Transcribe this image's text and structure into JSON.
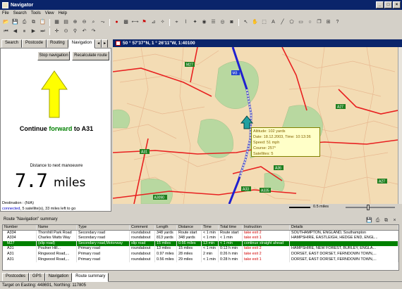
{
  "window": {
    "title": "Navigator"
  },
  "menu": [
    "File",
    "Search",
    "Tools",
    "View",
    "Help"
  ],
  "left_tabs": [
    "Search",
    "Postcode",
    "Routing",
    "Navigation"
  ],
  "left_tab_arrows": [
    "◂",
    "▸"
  ],
  "left_panel": {
    "stop_label": "Stop navigation",
    "recalc_label": "Recalculate route",
    "instruction_prefix": "Continue ",
    "instruction_highlight": "forward",
    "instruction_suffix": " to A31",
    "distance_caption": "Distance to next manoeuvre",
    "distance_value": "7.7",
    "distance_unit": "miles",
    "destination": "Destination : (N/A)",
    "status_prefix": "connected",
    "status_rest": ", 5 satellite(s), 33 miles left to go",
    "arrow_color": "#ffff00",
    "highlight_color": "#008000"
  },
  "map": {
    "header": "50 ° 57'37\"N, 1 ° 26'11\"W, 1:40100",
    "info": {
      "altitude": "Altitude: 102 yards",
      "date": "Date: 18.12.2003, Time: 10:13:36",
      "speed": "Speed: 51 mph",
      "course": "Course: 257°",
      "satellites": "Satellites: 5"
    },
    "road_labels": [
      "M27",
      "A27",
      "A36",
      "A31",
      "A3090",
      "A335",
      "A33",
      "M3",
      "A27"
    ],
    "scale_label": "0.5 miles"
  },
  "summary": {
    "title": "Route \"Navigation\" summary",
    "columns": [
      "Number",
      "Name",
      "Type",
      "Comment",
      "Length",
      "Distance",
      "Time",
      "Total time",
      "Instruction",
      "Details"
    ],
    "rows": [
      [
        "A334",
        "Thornhill Park Road",
        "Secondary road",
        "roundabout",
        "348 yards",
        "Route start",
        "< 1 min",
        "Route start",
        "take exit 2",
        "SOUTHAMPTON, ENGLAND, Southampton"
      ],
      [
        "A334",
        "Charles Watts Way",
        "Secondary road",
        "roundabout",
        "813 yards",
        "348 yards",
        "< 1 min",
        "< 1 min",
        "take exit 1",
        "HAMPSHIRE, EASTLEIGH, HEDGE END, ENGL..."
      ],
      [
        "M27",
        "(slip road)",
        "Secondary road,Motorway",
        "slip road",
        "15 miles",
        "0.66 miles",
        "13 min",
        "< 1 min",
        "continue straight ahead",
        ""
      ],
      [
        "A31",
        "Poulner Hill...",
        "Primary road",
        "roundabout",
        "13 miles",
        "15 miles",
        "< 1 min",
        "0:13 h min",
        "take exit 2",
        "HAMPSHIRE, NEW FOREST, BURLEY, ENGLA..."
      ],
      [
        "A31",
        "Ringwood Road,...",
        "Primary road",
        "roundabout",
        "0.97 miles",
        "28 miles",
        "2 min",
        "0:26 h min",
        "take exit 2",
        "DORSET, EAST DORSET, FERNDOWN TOWN,..."
      ],
      [
        "A31",
        "Ringwood Road,...",
        "Primary road",
        "roundabout",
        "0.56 miles",
        "29 miles",
        "< 1 min",
        "0:28 h min",
        "take exit 1",
        "DORSET, EAST DORSET, FERNDOWN TOWN,..."
      ]
    ],
    "selected_row": 2,
    "tabs": [
      "Postcodes",
      "GPS",
      "Navigation",
      "Route summary"
    ]
  },
  "statusbar": "Target on Easting: 448691, Northing: 117805"
}
